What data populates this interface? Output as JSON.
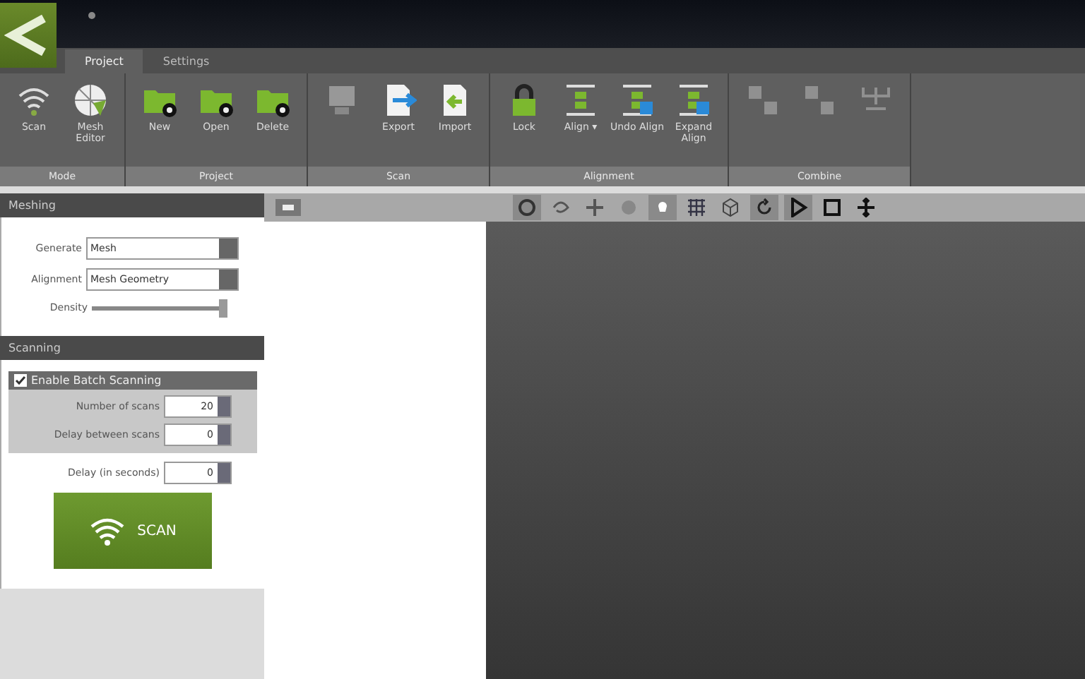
{
  "tabs": [
    {
      "label": "Project",
      "selected": true
    },
    {
      "label": "Settings",
      "selected": false
    }
  ],
  "ribbon": [
    {
      "label": "Mode",
      "buttons": [
        {
          "label": "Scan",
          "kind": "wifi",
          "disabled": false
        },
        {
          "label": "Mesh Editor",
          "kind": "sphere",
          "disabled": false
        }
      ]
    },
    {
      "label": "Project",
      "buttons": [
        {
          "label": "New",
          "kind": "folder-plus",
          "disabled": false
        },
        {
          "label": "Open",
          "kind": "folder-open",
          "disabled": false
        },
        {
          "label": "Delete",
          "kind": "folder-minus",
          "disabled": false
        }
      ]
    },
    {
      "label": "Scan",
      "buttons": [
        {
          "kind": "monitor",
          "disabled": true
        },
        {
          "label": "Export",
          "kind": "export",
          "disabled": false
        },
        {
          "label": "Import",
          "kind": "import",
          "disabled": false
        }
      ]
    },
    {
      "label": "Alignment",
      "buttons": [
        {
          "label": "Lock",
          "kind": "lock",
          "disabled": false
        },
        {
          "label": "Align ▾",
          "kind": "align",
          "disabled": false
        },
        {
          "label": "Undo Align",
          "kind": "align-undo",
          "disabled": false
        },
        {
          "label": "Expand Align",
          "kind": "align-expand",
          "disabled": false
        }
      ]
    },
    {
      "label": "Combine",
      "buttons": [
        {
          "kind": "combine",
          "disabled": true
        },
        {
          "kind": "combine",
          "disabled": true
        },
        {
          "kind": "fork",
          "disabled": true
        }
      ]
    }
  ],
  "viewport_toolbar": [
    {
      "kind": "target",
      "selected": true
    },
    {
      "kind": "lasso",
      "selected": false
    },
    {
      "kind": "crosshair",
      "selected": false
    },
    {
      "kind": "dot",
      "selected": false
    },
    {
      "kind": "bulb",
      "selected": true
    },
    {
      "kind": "grid",
      "selected": false
    },
    {
      "kind": "cube",
      "selected": false
    },
    {
      "kind": "rotate",
      "selected": true
    },
    {
      "kind": "play",
      "selected": true
    },
    {
      "kind": "stop",
      "selected": false
    },
    {
      "kind": "move",
      "selected": false
    }
  ],
  "meshing": {
    "title": "Meshing",
    "generate": {
      "label": "Generate",
      "value": "Mesh"
    },
    "alignment": {
      "label": "Alignment",
      "value": "Mesh Geometry"
    },
    "density": {
      "label": "Density",
      "level": 0.97
    }
  },
  "scanning": {
    "title": "Scanning",
    "batch": {
      "label": "Enable Batch Scanning",
      "checked": true
    },
    "number_of_scans": {
      "label": "Number of scans",
      "value": "20"
    },
    "delay_between": {
      "label": "Delay between scans",
      "value": "0"
    },
    "delay": {
      "label": "Delay (in seconds)",
      "value": "0"
    },
    "scan_button": "SCAN"
  }
}
